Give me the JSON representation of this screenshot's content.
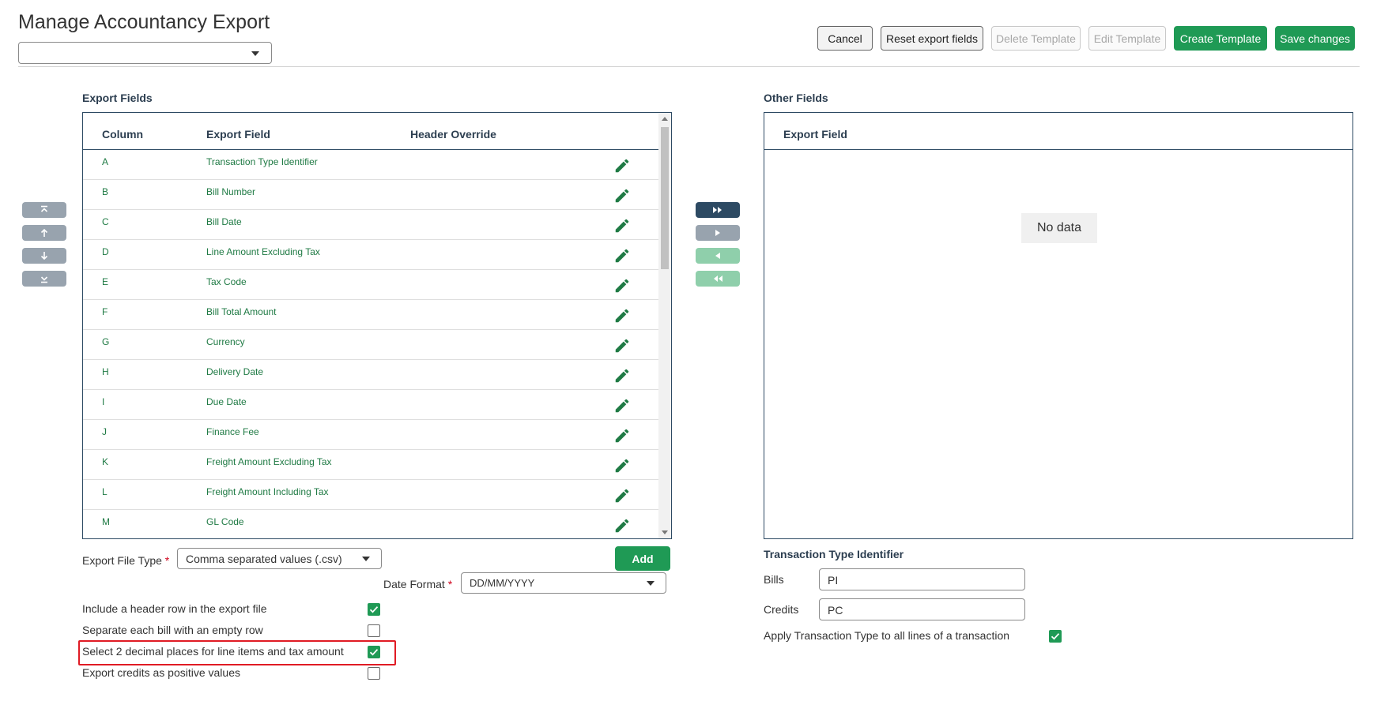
{
  "page": {
    "title": "Manage Accountancy Export",
    "template_select_value": ""
  },
  "toolbar": {
    "cancel": "Cancel",
    "reset": "Reset export fields",
    "delete_template": "Delete Template",
    "edit_template": "Edit Template",
    "create_template": "Create Template",
    "save_changes": "Save changes"
  },
  "order_controls": [
    "move-top-icon",
    "move-up-icon",
    "move-down-icon",
    "move-bottom-icon"
  ],
  "transfer_controls": [
    "move-all-right-icon",
    "move-right-icon",
    "move-left-icon",
    "move-all-left-icon"
  ],
  "export_fields": {
    "label": "Export Fields",
    "columns": {
      "column": "Column",
      "field": "Export Field",
      "override": "Header Override"
    },
    "rows": [
      {
        "col": "A",
        "field": "Transaction Type Identifier",
        "override": ""
      },
      {
        "col": "B",
        "field": "Bill Number",
        "override": ""
      },
      {
        "col": "C",
        "field": "Bill Date",
        "override": ""
      },
      {
        "col": "D",
        "field": "Line Amount Excluding Tax",
        "override": ""
      },
      {
        "col": "E",
        "field": "Tax Code",
        "override": ""
      },
      {
        "col": "F",
        "field": "Bill Total Amount",
        "override": ""
      },
      {
        "col": "G",
        "field": "Currency",
        "override": ""
      },
      {
        "col": "H",
        "field": "Delivery Date",
        "override": ""
      },
      {
        "col": "I",
        "field": "Due Date",
        "override": ""
      },
      {
        "col": "J",
        "field": "Finance Fee",
        "override": ""
      },
      {
        "col": "K",
        "field": "Freight Amount Excluding Tax",
        "override": ""
      },
      {
        "col": "L",
        "field": "Freight Amount Including Tax",
        "override": ""
      },
      {
        "col": "M",
        "field": "GL Code",
        "override": ""
      }
    ]
  },
  "other_fields": {
    "label": "Other Fields",
    "column": "Export Field",
    "empty": "No data"
  },
  "options": {
    "file_type_label": "Export File Type",
    "required_mark": "*",
    "file_type_value": "Comma separated values (.csv)",
    "add_button": "Add",
    "date_format_label": "Date Format",
    "date_format_value": "DD/MM/YYYY",
    "checkboxes": [
      {
        "label": "Include a header row in the export file",
        "checked": true
      },
      {
        "label": "Separate each bill with an empty row",
        "checked": false
      },
      {
        "label": "Select 2 decimal places for line items and tax amount",
        "checked": true
      },
      {
        "label": "Export credits as positive values",
        "checked": false
      }
    ]
  },
  "transaction_type": {
    "label": "Transaction Type Identifier",
    "bills_label": "Bills",
    "bills_value": "PI",
    "credits_label": "Credits",
    "credits_value": "PC",
    "apply_label": "Apply Transaction Type to all lines of a transaction",
    "apply_checked": true
  },
  "colors": {
    "accent_green": "#1f9a55",
    "field_text_green": "#1f7a44",
    "navy": "#2d4a63",
    "highlight_red": "#e01b24"
  }
}
